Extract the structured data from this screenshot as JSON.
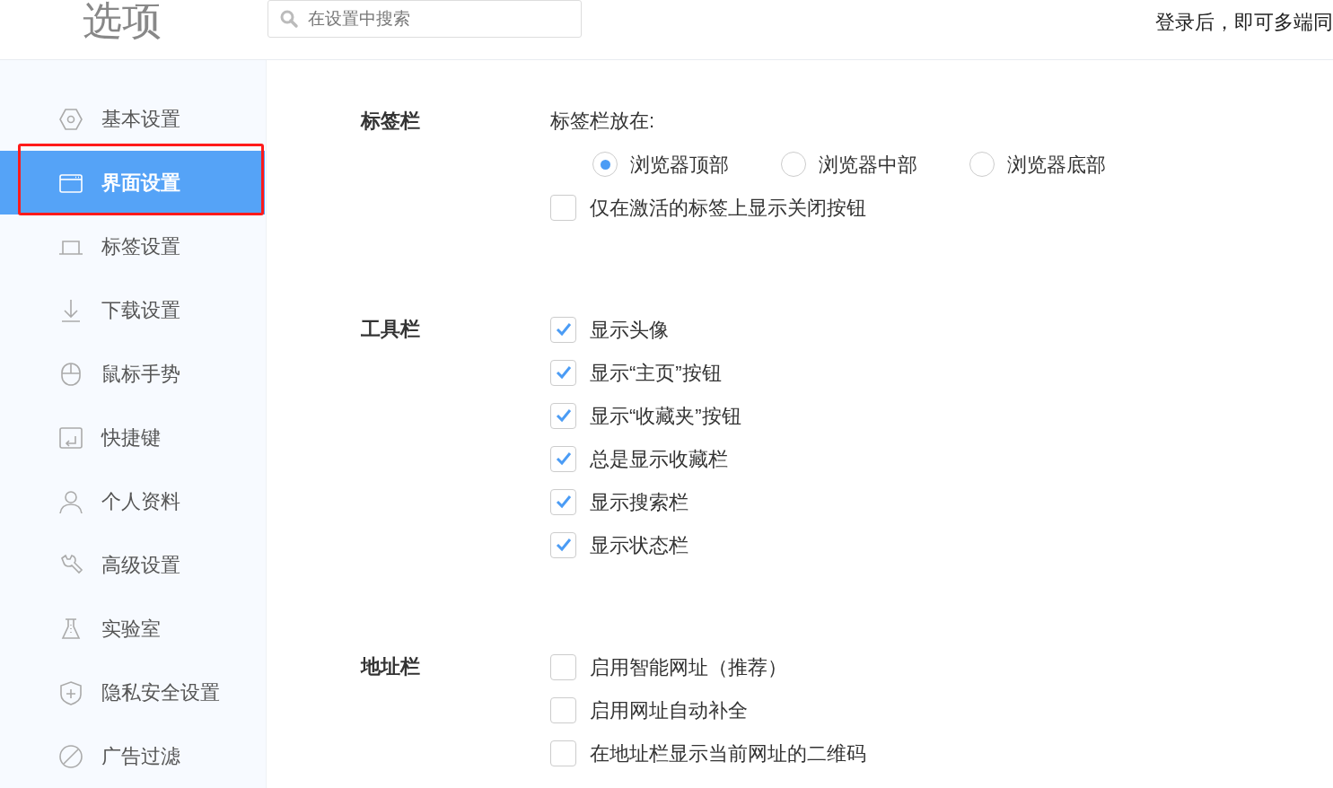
{
  "header": {
    "title": "选项",
    "search": {
      "placeholder": "在设置中搜索"
    },
    "login_hint": "登录后，即可多端同"
  },
  "sidebar": {
    "items": [
      {
        "label": "基本设置",
        "selected": false
      },
      {
        "label": "界面设置",
        "selected": true
      },
      {
        "label": "标签设置",
        "selected": false
      },
      {
        "label": "下载设置",
        "selected": false
      },
      {
        "label": "鼠标手势",
        "selected": false
      },
      {
        "label": "快捷键",
        "selected": false
      },
      {
        "label": "个人资料",
        "selected": false
      },
      {
        "label": "高级设置",
        "selected": false
      },
      {
        "label": "实验室",
        "selected": false
      },
      {
        "label": "隐私安全设置",
        "selected": false
      },
      {
        "label": "广告过滤",
        "selected": false
      }
    ]
  },
  "sections": [
    {
      "title": "标签栏",
      "subtitle": "标签栏放在:",
      "radios": [
        {
          "label": "浏览器顶部",
          "selected": true
        },
        {
          "label": "浏览器中部",
          "selected": false
        },
        {
          "label": "浏览器底部",
          "selected": false
        }
      ],
      "checkboxes": [
        {
          "label": "仅在激活的标签上显示关闭按钮",
          "checked": false
        }
      ]
    },
    {
      "title": "工具栏",
      "checkboxes": [
        {
          "label": "显示头像",
          "checked": true
        },
        {
          "label": "显示“主页”按钮",
          "checked": true
        },
        {
          "label": "显示“收藏夹”按钮",
          "checked": true
        },
        {
          "label": "总是显示收藏栏",
          "checked": true
        },
        {
          "label": "显示搜索栏",
          "checked": true
        },
        {
          "label": "显示状态栏",
          "checked": true
        }
      ]
    },
    {
      "title": "地址栏",
      "checkboxes": [
        {
          "label": "启用智能网址（推荐）",
          "checked": false
        },
        {
          "label": "启用网址自动补全",
          "checked": false
        },
        {
          "label": "在地址栏显示当前网址的二维码",
          "checked": false
        }
      ]
    }
  ]
}
